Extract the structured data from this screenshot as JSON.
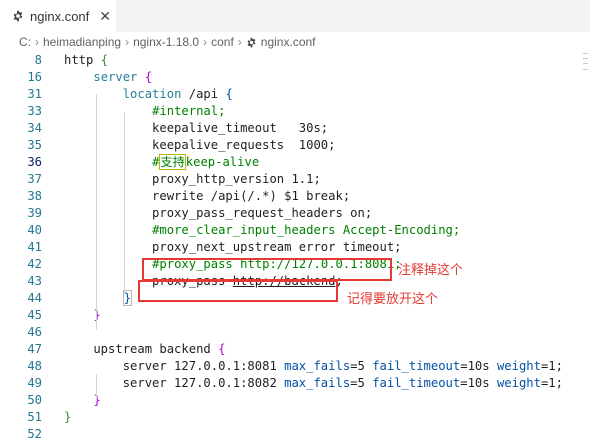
{
  "tab": {
    "title": "nginx.conf",
    "close_glyph": "✕",
    "icon": "gear-icon"
  },
  "breadcrumb": {
    "items": [
      "C:",
      "heimadianping",
      "nginx-1.18.0",
      "conf",
      "nginx.conf"
    ],
    "separator": "›"
  },
  "editor": {
    "lines": [
      {
        "num": "8",
        "tokens": [
          [
            "plain",
            "http "
          ],
          [
            "brace-y",
            "{"
          ]
        ]
      },
      {
        "num": "16",
        "tokens": [
          [
            "plain",
            "    "
          ],
          [
            "kw",
            "server"
          ],
          [
            "plain",
            " "
          ],
          [
            "brace-p",
            "{"
          ]
        ]
      },
      {
        "num": "31",
        "tokens": [
          [
            "plain",
            "        "
          ],
          [
            "kw",
            "location"
          ],
          [
            "plain",
            " /api "
          ],
          [
            "blue",
            "{"
          ]
        ]
      },
      {
        "num": "33",
        "tokens": [
          [
            "plain",
            "            "
          ],
          [
            "comment",
            "#internal;"
          ]
        ]
      },
      {
        "num": "34",
        "tokens": [
          [
            "plain",
            "            keepalive_timeout   30s;"
          ]
        ]
      },
      {
        "num": "35",
        "tokens": [
          [
            "plain",
            "            keepalive_requests  1000;"
          ]
        ]
      },
      {
        "num": "36",
        "tokens": [
          [
            "plain",
            "            "
          ],
          [
            "comment",
            "#"
          ],
          [
            "comment cursor-box",
            "支持"
          ],
          [
            "comment",
            "keep-alive"
          ]
        ],
        "active": true
      },
      {
        "num": "37",
        "tokens": [
          [
            "plain",
            "            proxy_http_version 1.1;"
          ]
        ]
      },
      {
        "num": "38",
        "tokens": [
          [
            "plain",
            "            rewrite /api(/.*) $1 break;"
          ]
        ]
      },
      {
        "num": "39",
        "tokens": [
          [
            "plain",
            "            proxy_pass_request_headers on;"
          ]
        ]
      },
      {
        "num": "40",
        "tokens": [
          [
            "plain",
            "            "
          ],
          [
            "comment",
            "#more_clear_input_headers Accept-Encoding;"
          ]
        ]
      },
      {
        "num": "41",
        "tokens": [
          [
            "plain",
            "            proxy_next_upstream error timeout;"
          ]
        ]
      },
      {
        "num": "42",
        "tokens": [
          [
            "plain",
            "            "
          ],
          [
            "comment",
            "#proxy_pass http://127.0.0.1:8081;"
          ]
        ]
      },
      {
        "num": "43",
        "tokens": [
          [
            "plain",
            "            proxy_pass "
          ],
          [
            "plain under",
            "http://backend"
          ],
          [
            "plain",
            ";"
          ]
        ]
      },
      {
        "num": "44",
        "tokens": [
          [
            "plain",
            "        "
          ],
          [
            "blue bracket-match",
            "}"
          ]
        ]
      },
      {
        "num": "45",
        "tokens": [
          [
            "plain",
            "    "
          ],
          [
            "brace-p",
            "}"
          ]
        ]
      },
      {
        "num": "46",
        "tokens": []
      },
      {
        "num": "47",
        "tokens": [
          [
            "plain",
            "    upstream backend "
          ],
          [
            "brace-p",
            "{"
          ]
        ]
      },
      {
        "num": "48",
        "tokens": [
          [
            "plain",
            "        server 127.0.0.1:8081 "
          ],
          [
            "blue",
            "max_fails"
          ],
          [
            "plain",
            "=5 "
          ],
          [
            "blue",
            "fail_timeout"
          ],
          [
            "plain",
            "=10s "
          ],
          [
            "blue",
            "weight"
          ],
          [
            "plain",
            "=1;"
          ]
        ]
      },
      {
        "num": "49",
        "tokens": [
          [
            "plain",
            "        server 127.0.0.1:8082 "
          ],
          [
            "blue",
            "max_fails"
          ],
          [
            "plain",
            "=5 "
          ],
          [
            "blue",
            "fail_timeout"
          ],
          [
            "plain",
            "=10s "
          ],
          [
            "blue",
            "weight"
          ],
          [
            "plain",
            "=1;"
          ]
        ]
      },
      {
        "num": "50",
        "tokens": [
          [
            "plain",
            "    "
          ],
          [
            "brace-p",
            "}"
          ]
        ]
      },
      {
        "num": "51",
        "tokens": [
          [
            "brace-y",
            "}"
          ]
        ]
      },
      {
        "num": "52",
        "tokens": []
      }
    ]
  },
  "annotations": {
    "comment_out": "注释掉这个",
    "uncomment": "记得要放开这个",
    "color": "#e53935"
  },
  "colors": {
    "keyword": "#267f99",
    "comment": "#008000",
    "line_number": "#237893",
    "param": "#0451a5"
  }
}
